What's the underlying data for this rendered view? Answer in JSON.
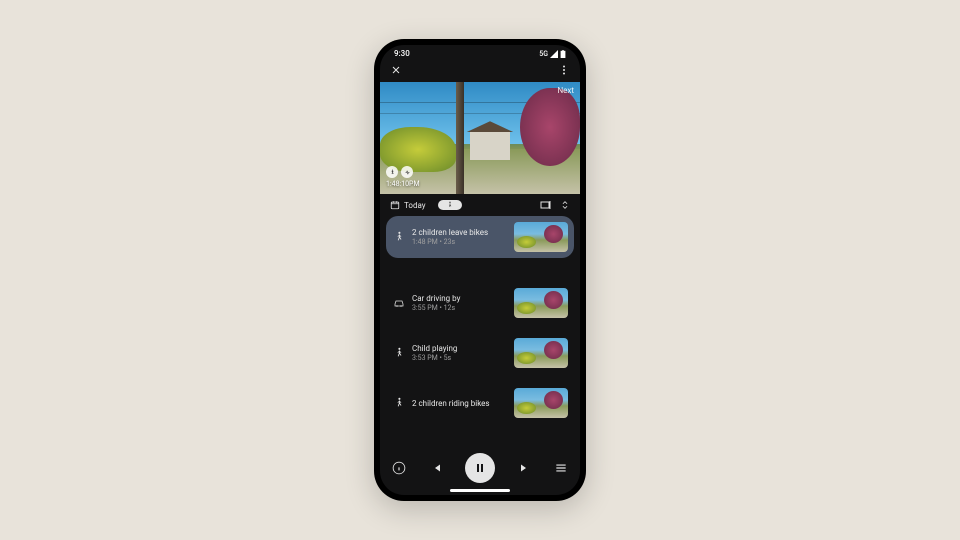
{
  "status": {
    "time": "9:30",
    "network": "5G"
  },
  "video": {
    "timestamp": "1:48:10PM",
    "next_label": "Next"
  },
  "filter": {
    "date_label": "Today"
  },
  "events": [
    {
      "icon": "person",
      "title": "2 children leave bikes",
      "time": "1:48 PM",
      "duration": "23s",
      "selected": true
    },
    {
      "icon": "car",
      "title": "Car driving by",
      "time": "3:55 PM",
      "duration": "12s",
      "selected": false
    },
    {
      "icon": "person",
      "title": "Child playing",
      "time": "3:53 PM",
      "duration": "5s",
      "selected": false
    },
    {
      "icon": "person",
      "title": "2 children riding bikes",
      "time": "",
      "duration": "",
      "selected": false
    }
  ]
}
